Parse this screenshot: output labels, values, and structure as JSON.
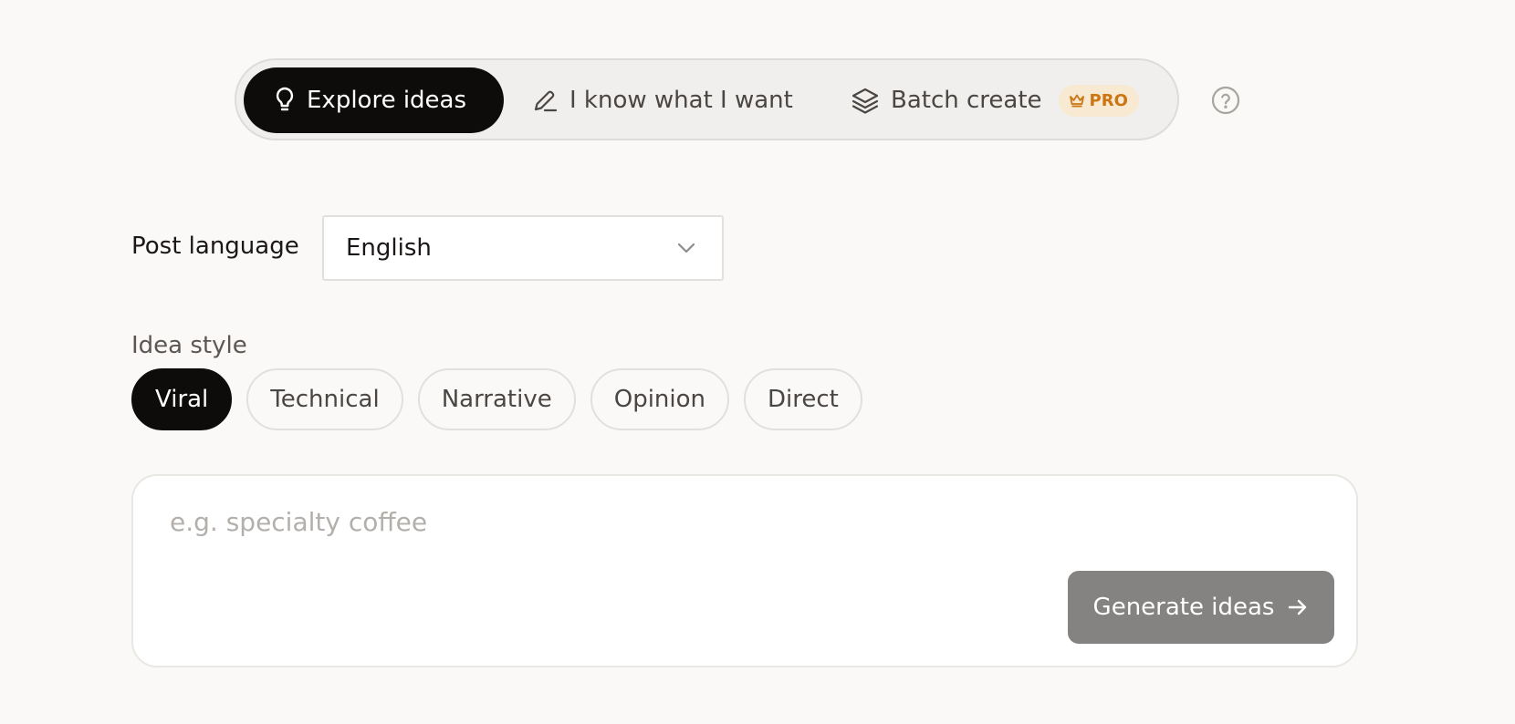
{
  "mode_tabs": [
    {
      "label": "Explore ideas",
      "icon": "lightbulb-icon",
      "active": true
    },
    {
      "label": "I know what I want",
      "icon": "pencil-icon",
      "active": false
    },
    {
      "label": "Batch create",
      "icon": "layers-icon",
      "active": false,
      "badge": "PRO"
    }
  ],
  "help_icon": "question-circle-icon",
  "language": {
    "label": "Post language",
    "value": "English"
  },
  "idea_style": {
    "label": "Idea style",
    "options": [
      "Viral",
      "Technical",
      "Narrative",
      "Opinion",
      "Direct"
    ],
    "selected": "Viral"
  },
  "topic": {
    "placeholder": "e.g. specialty coffee",
    "value": ""
  },
  "generate_button": {
    "label": "Generate ideas"
  },
  "colors": {
    "background": "#faf9f7",
    "active_dark": "#0e0c0b",
    "pro_badge_bg": "#f8e9d2",
    "pro_badge_text": "#cc7613",
    "button_disabled": "#858381"
  }
}
